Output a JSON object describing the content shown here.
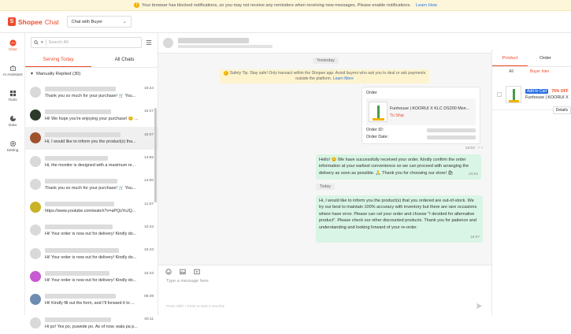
{
  "notice": {
    "text": "Your browser has blocked notifications, so you may not receive any reminders when receiving new messages. Please enable notifications.",
    "link": "Learn How"
  },
  "app": {
    "logo_brand": "Shopee",
    "logo_product": "Chat",
    "mode_select": "Chat with Buyer"
  },
  "rail": [
    {
      "label": "Chat",
      "icon": "chat-icon"
    },
    {
      "label": "AI Assistant",
      "icon": "robot-icon"
    },
    {
      "label": "Tools",
      "icon": "tools-icon"
    },
    {
      "label": "Data",
      "icon": "chart-icon"
    },
    {
      "label": "Setting",
      "icon": "gear-icon"
    }
  ],
  "list": {
    "search_placeholder": "Search All",
    "tabs": [
      "Serving Today",
      "All Chats"
    ],
    "group_label": "Manually Replied (30)",
    "conversations": [
      {
        "time": "16:24",
        "message": "Thank you so much for your purchase! 🛒 You..."
      },
      {
        "time": "16:27",
        "message": "Hi! We hope you're enjoying your purchase! 😊 ..."
      },
      {
        "time": "16:07",
        "message": "Hi, I would like to inform you the product(s) tha..."
      },
      {
        "time": "14:55",
        "message": "Hi, the monitor is designed with a maximum re..."
      },
      {
        "time": "14:00",
        "message": "Thank you so much for your purchase! 🛒 You..."
      },
      {
        "time": "11:07",
        "message": "https://www.youtube.com/watch?v=aPQsYoJQ..."
      },
      {
        "time": "10:43",
        "message": "Hi! Your order is now out for delivery! Kindly do..."
      },
      {
        "time": "10:43",
        "message": "Hi! Your order is now out for delivery! Kindly do..."
      },
      {
        "time": "10:43",
        "message": "Hi! Your order is now out for delivery! Kindly do..."
      },
      {
        "time": "08:39",
        "message": "Hi! Kindly fill out the form, and I'll forward it to ..."
      },
      {
        "time": "00:11",
        "message": "Hi po! Yes po, puwede po. As of now, wala pa p..."
      }
    ]
  },
  "chat": {
    "day1": "Yesterday",
    "tip_text": "Safety Tip: Stay safe! Only transact within the Shopee app. Avoid buyers who ask you to deal or ask payments outside the platform.",
    "tip_link": "Learn More",
    "order": {
      "heading": "Order",
      "product": "Funhouse | KOORUI X KLC DS200 Mon...",
      "status": "To Ship",
      "id_label": "Order ID:",
      "date_label": "Order Date:",
      "time": "23:02"
    },
    "msg1": {
      "text": "Hello! 😊 We have successfully received your order. Kindly confirm the order information at your earliest convenience so we can proceed with arranging the delivery as soon as possible. 🙏 Thank you for choosing our store! 🛍",
      "time": "23:02"
    },
    "day2": "Today",
    "msg2": {
      "text": "Hi, I would like to inform you the product(s) that you ordered are out-of-stock. We try our best to maintain 100% accuracy with inventory but there are rare occasions where have error. Please can cel your order and choose \"I decided for alternative product\". Please check our other discounted products. Thank you for patience and understanding and looking forward of your re-order.",
      "time": "16:07"
    },
    "input_placeholder": "Type a message here",
    "hint": "Press Shift + Enter to start a new line"
  },
  "right": {
    "tabs": [
      "Product",
      "Order"
    ],
    "subtabs": [
      "All",
      "Buyer Inter"
    ],
    "item": {
      "badge": "Add to Cart",
      "discount": "76% OFF",
      "name": "Funhouse | KOORUI X",
      "details": "Details"
    }
  },
  "colors": {
    "brand": "#ee4d2d",
    "bubble": "#d9f5e5",
    "link": "#2673dd"
  }
}
